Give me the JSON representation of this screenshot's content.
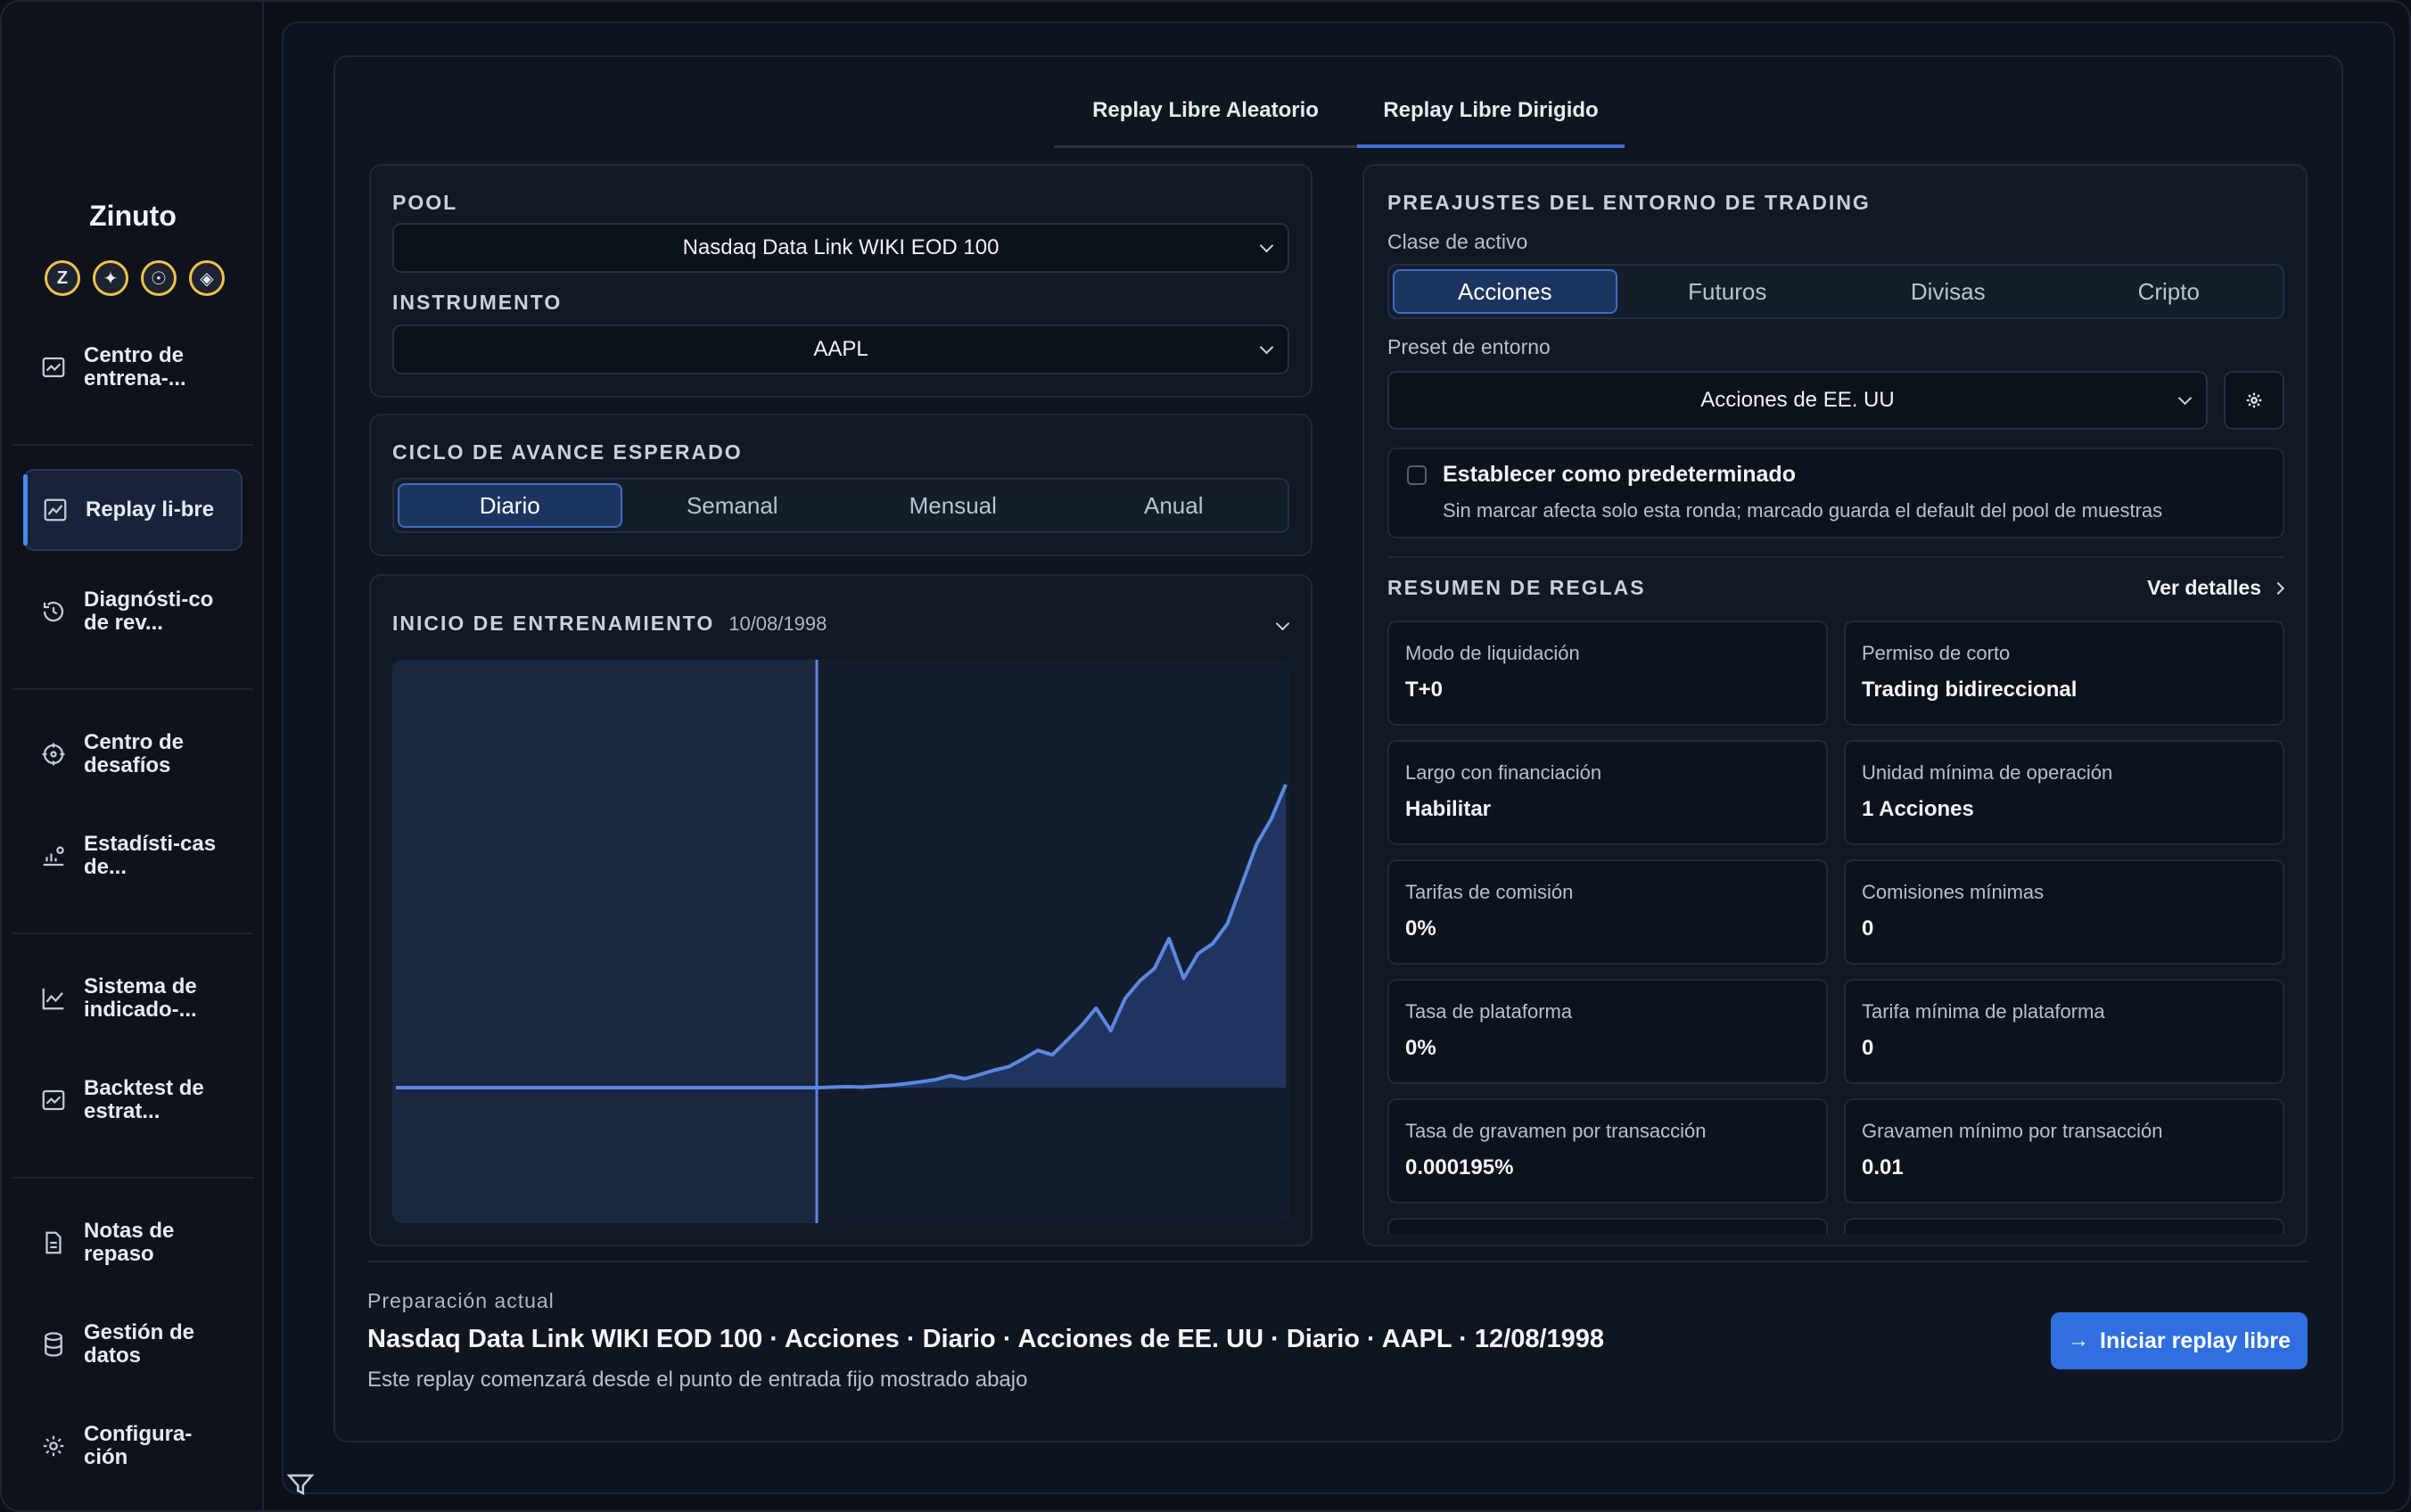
{
  "app": {
    "name": "Zinuto",
    "badges": [
      "Z",
      "✦",
      "☉",
      "◈"
    ]
  },
  "sidebar": {
    "items": [
      {
        "label": "Centro de entrena-...",
        "icon": "chart-image-icon"
      },
      {
        "label": "Replay li-bre",
        "icon": "trend-chart-icon"
      },
      {
        "label": "Diagnósti-co de rev...",
        "icon": "history-icon"
      },
      {
        "label": "Centro de desafíos",
        "icon": "target-icon"
      },
      {
        "label": "Estadísti-cas de...",
        "icon": "stats-user-icon"
      },
      {
        "label": "Sistema de indicado-...",
        "icon": "line-chart-icon"
      },
      {
        "label": "Backtest de estrat...",
        "icon": "chart-image-icon"
      },
      {
        "label": "Notas de repaso",
        "icon": "document-icon"
      },
      {
        "label": "Gestión de datos",
        "icon": "database-icon"
      },
      {
        "label": "Configura-ción",
        "icon": "gear-icon"
      }
    ]
  },
  "tabs": [
    "Replay Libre Aleatorio",
    "Replay Libre Dirigido"
  ],
  "pool": {
    "title": "POOL",
    "value": "Nasdaq Data Link WIKI EOD 100"
  },
  "instrument": {
    "title": "INSTRUMENTO",
    "value": "AAPL"
  },
  "cycle": {
    "title": "CICLO DE AVANCE ESPERADO",
    "options": [
      "Diario",
      "Semanal",
      "Mensual",
      "Anual"
    ],
    "selected": "Diario"
  },
  "start": {
    "title": "INICIO DE ENTRENAMIENTO",
    "date": "10/08/1998"
  },
  "chart_data": {
    "type": "area",
    "title": "",
    "xlabel": "",
    "ylabel": "",
    "marker_date": "10/08/1998",
    "values": [
      1,
      1,
      1,
      1,
      1,
      1,
      1,
      1,
      1,
      1,
      1,
      1,
      1,
      1,
      1,
      1,
      1,
      1,
      1,
      1,
      1,
      1,
      1,
      1,
      1,
      1,
      1,
      1,
      1,
      1,
      1.1,
      1.2,
      1.1,
      1.3,
      1.5,
      1.8,
      2.2,
      2.6,
      3.4,
      2.8,
      3.6,
      4.5,
      5.2,
      6.8,
      8.5,
      7.6,
      10.5,
      13.5,
      17,
      12.5,
      19,
      22.5,
      25,
      31,
      23,
      28,
      30,
      34,
      42,
      50,
      55,
      62
    ],
    "series": [
      {
        "name": "",
        "color": "#5b88e0"
      }
    ]
  },
  "env": {
    "title": "PREAJUSTES DEL ENTORNO DE TRADING",
    "asset_class_label": "Clase de activo",
    "asset_classes": [
      "Acciones",
      "Futuros",
      "Divisas",
      "Cripto"
    ],
    "asset_selected": "Acciones",
    "preset_label": "Preset de entorno",
    "preset_value": "Acciones de EE. UU",
    "default_title": "Establecer como predeterminado",
    "default_desc": "Sin marcar afecta solo esta ronda; marcado guarda el default del pool de muestras"
  },
  "rules": {
    "title": "RESUMEN DE REGLAS",
    "details_link": "Ver detalles",
    "items": [
      {
        "k": "Modo de liquidación",
        "v": "T+0"
      },
      {
        "k": "Permiso de corto",
        "v": "Trading bidireccional"
      },
      {
        "k": "Largo con financiación",
        "v": "Habilitar"
      },
      {
        "k": "Unidad mínima de operación",
        "v": "1 Acciones"
      },
      {
        "k": "Tarifas de comisión",
        "v": "0%"
      },
      {
        "k": "Comisiones mínimas",
        "v": "0"
      },
      {
        "k": "Tasa de plataforma",
        "v": "0%"
      },
      {
        "k": "Tarifa mínima de plataforma",
        "v": "0"
      },
      {
        "k": "Tasa de gravamen por transacción",
        "v": "0.000195%"
      },
      {
        "k": "Gravamen mínimo por transacción",
        "v": "0.01"
      }
    ]
  },
  "summary": {
    "label": "Preparación actual",
    "value": "Nasdaq Data Link WIKI EOD 100 · Acciones · Diario · Acciones de EE. UU · Diario · AAPL · 12/08/1998",
    "note": "Este replay comenzará desde el punto de entrada fijo mostrado abajo"
  },
  "start_button": "Iniciar replay libre",
  "colors": {
    "accent": "#2f6fe0",
    "chart_line": "#5b88e0",
    "bg": "#0c1119"
  }
}
